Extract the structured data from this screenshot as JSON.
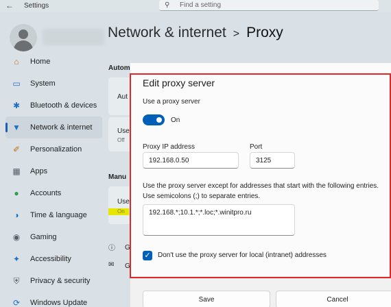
{
  "window": {
    "app_title": "Settings",
    "back_icon": "back-arrow-icon",
    "search_placeholder": "Find a setting"
  },
  "breadcrumb": {
    "parent": "Network & internet",
    "separator": ">",
    "current": "Proxy"
  },
  "sidebar": {
    "items": [
      {
        "label": "Home",
        "icon": "home-icon",
        "color": "#c0701a"
      },
      {
        "label": "System",
        "icon": "system-icon",
        "color": "#1f6fc4"
      },
      {
        "label": "Bluetooth & devices",
        "icon": "bluetooth-icon",
        "color": "#1f6fc4"
      },
      {
        "label": "Network & internet",
        "icon": "network-icon",
        "color": "#1f6fc4"
      },
      {
        "label": "Personalization",
        "icon": "brush-icon",
        "color": "#c0701a"
      },
      {
        "label": "Apps",
        "icon": "apps-icon",
        "color": "#555e66"
      },
      {
        "label": "Accounts",
        "icon": "accounts-icon",
        "color": "#2e9d4f"
      },
      {
        "label": "Time & language",
        "icon": "globe-icon",
        "color": "#1f6fc4"
      },
      {
        "label": "Gaming",
        "icon": "gaming-icon",
        "color": "#555e66"
      },
      {
        "label": "Accessibility",
        "icon": "accessibility-icon",
        "color": "#1f6fc4"
      },
      {
        "label": "Privacy & security",
        "icon": "shield-icon",
        "color": "#555e66"
      },
      {
        "label": "Windows Update",
        "icon": "update-icon",
        "color": "#1f6fc4"
      }
    ],
    "active_index": 3
  },
  "background_fragments": {
    "auto_section": "Autom",
    "auto_card": "Aut",
    "use_setup": "Use",
    "off": "Off",
    "manual_section": "Manu",
    "use_proxy": "Use",
    "on": "On",
    "help_1": "G",
    "help_2": "G"
  },
  "dialog": {
    "title": "Edit proxy server",
    "use_proxy_label": "Use a proxy server",
    "toggle_state": "On",
    "toggle_on": true,
    "ip_label": "Proxy IP address",
    "ip_value": "192.168.0.50",
    "port_label": "Port",
    "port_value": "3125",
    "exceptions_line1": "Use the proxy server except for addresses that start with the following entries.",
    "exceptions_line2": "Use semicolons (;) to separate entries.",
    "exceptions_value": "192.168.*;10.1.*;*.loc;*.winitpro.ru",
    "local_checkbox_label": "Don't use the proxy server for local (intranet) addresses",
    "local_checked": true,
    "save_label": "Save",
    "cancel_label": "Cancel",
    "accent_color": "#005fb8",
    "highlight_color": "#e0252b"
  }
}
